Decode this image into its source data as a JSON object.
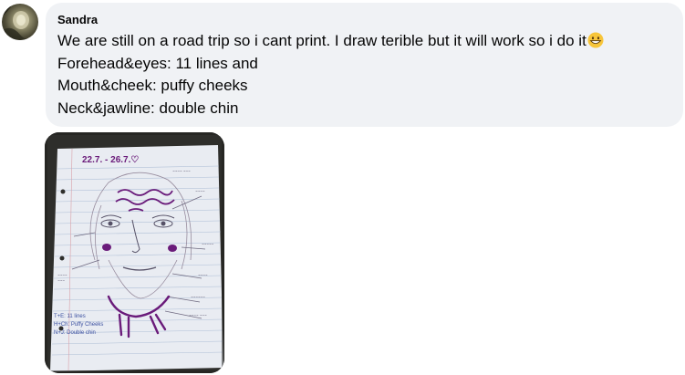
{
  "comment": {
    "author": "Sandra",
    "lines": [
      "We are still on a road trip so i cant print. I draw terible but it will work so i do it",
      "Forehead&eyes: 11 lines and",
      "Mouth&cheek: puffy cheeks",
      "Neck&jawline: double chin"
    ],
    "emoji": "grinning-face-emoji"
  },
  "photo": {
    "date_text": "22.7. - 26.7.♡",
    "note_t": "T+E: 11 lines",
    "note_h": "H+Ch: Puffy Cheeks",
    "note_n": "N+J: Double chin"
  },
  "colors": {
    "bubble_bg": "#f0f2f5",
    "text": "#050505",
    "ink_purple": "#6a1b7a"
  }
}
